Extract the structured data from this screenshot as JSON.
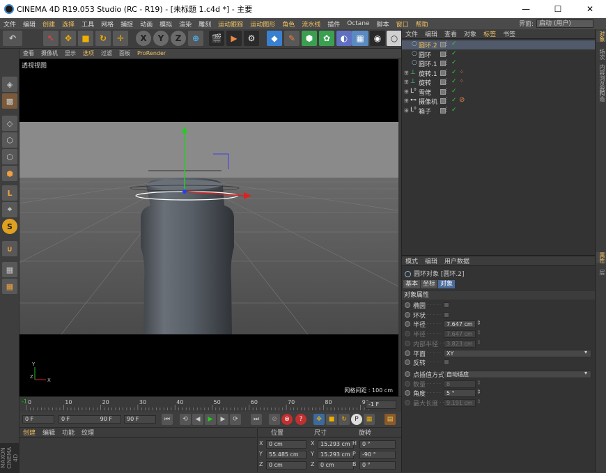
{
  "window": {
    "title": "CINEMA 4D R19.053 Studio (RC - R19) - [未标题 1.c4d *] - 主要",
    "minimize": "—",
    "maximize": "☐",
    "close": "✕"
  },
  "menubar": {
    "items": [
      "文件",
      "编辑",
      "创建",
      "选择",
      "工具",
      "网格",
      "捕捉",
      "动画",
      "模拟",
      "渲染",
      "雕刻",
      "运动跟踪",
      "运动图形",
      "角色",
      "流水线",
      "插件",
      "Octane",
      "脚本",
      "窗口",
      "帮助"
    ],
    "highlighted": [
      2,
      3,
      11,
      12,
      13,
      14,
      18,
      19
    ],
    "layout_label": "界面:",
    "layout_value": "启动 (用户)"
  },
  "viewport_menu": {
    "items": [
      "查看",
      "摄像机",
      "显示",
      "选项",
      "过滤",
      "面板",
      "ProRender"
    ],
    "highlighted": [
      3,
      6
    ],
    "name": "透视视图",
    "grid_spacing": "网格间距 : 100 cm"
  },
  "timeline": {
    "ticks": [
      "0",
      "10",
      "20",
      "30",
      "40",
      "50",
      "60",
      "70",
      "80",
      "90"
    ],
    "current": "-1",
    "end": "-1 F"
  },
  "transport": {
    "start": "0 F",
    "range_start": "0 F",
    "range_end": "90 F",
    "end": "90 F"
  },
  "material_manager": {
    "menu": [
      "创建",
      "编辑",
      "功能",
      "纹理"
    ]
  },
  "coords": {
    "headers": [
      "位置",
      "尺寸",
      "旋转"
    ],
    "rows": [
      {
        "axis": "X",
        "pos": "0 cm",
        "size_axis": "X",
        "size": "15.293 cm",
        "rot_axis": "H",
        "rot": "0 °"
      },
      {
        "axis": "Y",
        "pos": "55.485 cm",
        "size_axis": "Y",
        "size": "15.293 cm",
        "rot_axis": "P",
        "rot": "-90 °"
      },
      {
        "axis": "Z",
        "pos": "0 cm",
        "size_axis": "Z",
        "size": "0 cm",
        "rot_axis": "B",
        "rot": "0 °"
      }
    ]
  },
  "object_manager": {
    "menu": [
      "文件",
      "编辑",
      "查看",
      "对象",
      "标签",
      "书签"
    ],
    "highlighted": [
      4
    ],
    "objects": [
      {
        "name": "圆环.2",
        "indent": 1,
        "icon": "circle-icon",
        "selected": true
      },
      {
        "name": "圆环",
        "indent": 1,
        "icon": "circle-icon",
        "selected": false
      },
      {
        "name": "圆环.1",
        "indent": 1,
        "icon": "circle-icon",
        "selected": false
      },
      {
        "name": "旋转.1",
        "indent": 0,
        "icon": "lathe-icon",
        "selected": false
      },
      {
        "name": "旋转",
        "indent": 0,
        "icon": "lathe-icon",
        "selected": false
      },
      {
        "name": "雪佬",
        "indent": 0,
        "icon": "null-icon",
        "selected": false
      },
      {
        "name": "摄像机",
        "indent": 0,
        "icon": "camera-icon",
        "selected": false
      },
      {
        "name": "箱子",
        "indent": 0,
        "icon": "null-icon",
        "selected": false
      }
    ]
  },
  "attribute_manager": {
    "menu": [
      "模式",
      "编辑",
      "用户数据"
    ],
    "object_title": "圆环对象 [圆环.2]",
    "tabs": [
      "基本",
      "坐标",
      "对象"
    ],
    "active_tab": 2,
    "section": "对象属性",
    "fields": [
      {
        "label": "椭圆",
        "kind": "check",
        "value": "",
        "enabled": true
      },
      {
        "label": "环状",
        "kind": "check",
        "value": "",
        "enabled": true
      },
      {
        "label": "半径",
        "kind": "num",
        "value": "7.647 cm",
        "enabled": true
      },
      {
        "label": "半径",
        "kind": "num",
        "value": "7.647 cm",
        "enabled": false
      },
      {
        "label": "内部半径",
        "kind": "num",
        "value": "3.823 cm",
        "enabled": false
      },
      {
        "label": "平面",
        "kind": "select",
        "value": "XY",
        "enabled": true
      },
      {
        "label": "反转",
        "kind": "check",
        "value": "",
        "enabled": true
      },
      {
        "label": "点插值方式",
        "kind": "select",
        "value": "自动适应",
        "enabled": true
      },
      {
        "label": "数量",
        "kind": "num",
        "value": "8",
        "enabled": false
      },
      {
        "label": "角度",
        "kind": "num",
        "value": "5 °",
        "enabled": true
      },
      {
        "label": "最大长度",
        "kind": "num",
        "value": "9.191 cm",
        "enabled": false
      }
    ]
  },
  "right_tabs": [
    "对象",
    "场次",
    "内容浏览器",
    "构造",
    "属性",
    "层"
  ],
  "branding": "MAXON CINEMA 4D",
  "colors": {
    "accent": "#f0c060",
    "selected_row": "#505a6a",
    "viewport_floor": "#5a5a5a",
    "bottle": "#5a6068"
  }
}
